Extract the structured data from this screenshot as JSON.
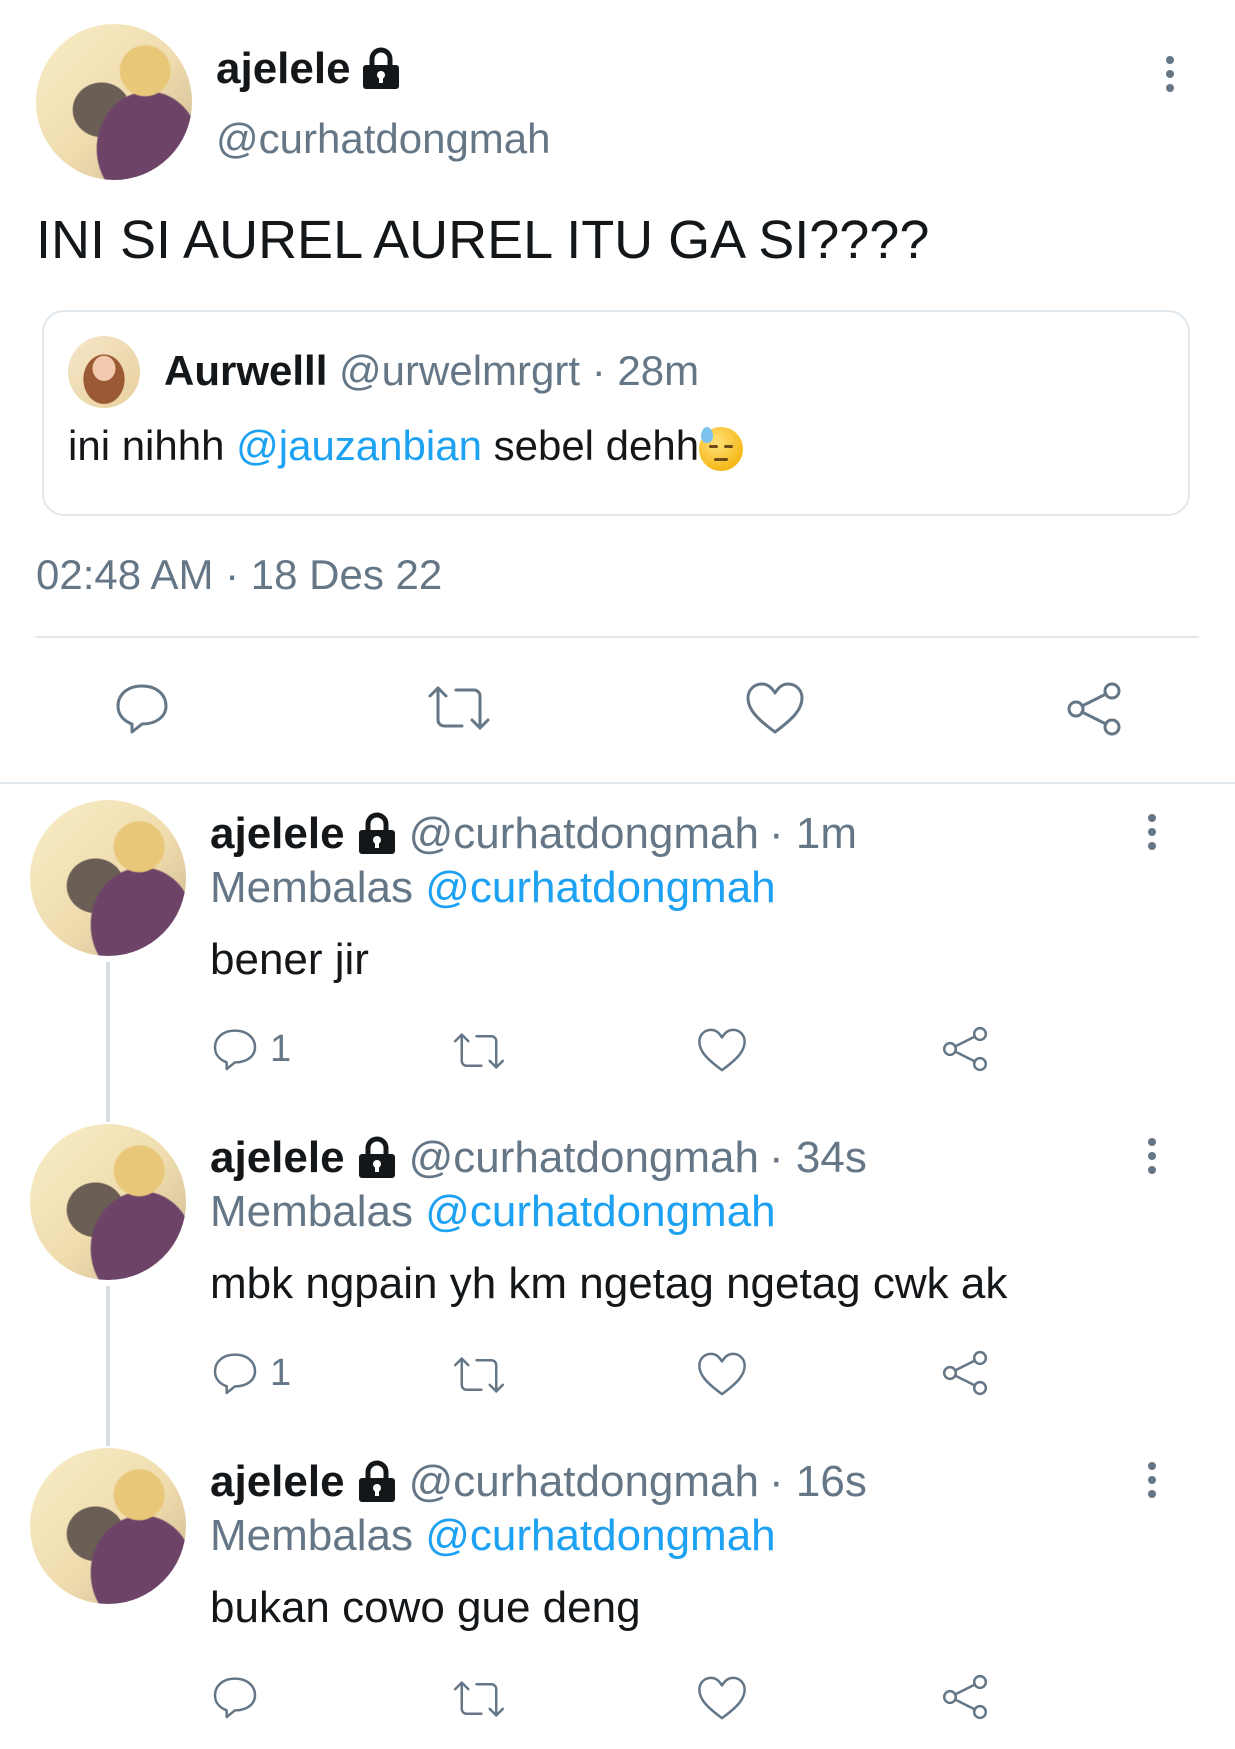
{
  "main_tweet": {
    "name": "ajelele",
    "handle": "@curhatdongmah",
    "text": "INI SI AUREL AUREL ITU GA SI????",
    "timestamp": "02:48 AM · 18 Des 22",
    "quote": {
      "name": "Aurwelll",
      "handle": "@urwelmrgrt",
      "time": "· 28m",
      "text_before": "ini nihhh ",
      "mention": "@jauzanbian",
      "text_after": " sebel dehh"
    }
  },
  "replies": [
    {
      "name": "ajelele",
      "handle": "@curhatdongmah",
      "time": "· 1m",
      "replying_label": "Membalas",
      "replying_to": "@curhatdongmah",
      "text": "bener jir",
      "reply_count": "1"
    },
    {
      "name": "ajelele",
      "handle": "@curhatdongmah",
      "time": "· 34s",
      "replying_label": "Membalas",
      "replying_to": "@curhatdongmah",
      "text": "mbk ngpain yh km ngetag ngetag cwk ak",
      "reply_count": "1"
    },
    {
      "name": "ajelele",
      "handle": "@curhatdongmah",
      "time": "· 16s",
      "replying_label": "Membalas",
      "replying_to": "@curhatdongmah",
      "text": "bukan cowo gue deng",
      "reply_count": ""
    }
  ],
  "icons": [
    "lock-icon",
    "more-icon",
    "reply-icon",
    "retweet-icon",
    "like-icon",
    "share-icon",
    "downcast-sweat-emoji"
  ],
  "colors": {
    "link": "#1da1f2",
    "secondary": "#657786",
    "text": "#14171a"
  }
}
